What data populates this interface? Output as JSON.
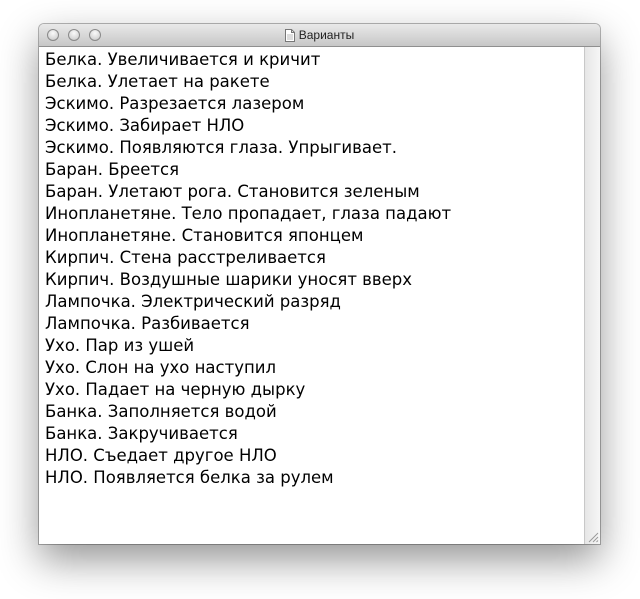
{
  "window": {
    "title": "Варианты",
    "title_icon": "document-icon"
  },
  "document": {
    "lines": [
      "Белка. Увеличивается и кричит",
      "Белка. Улетает на ракете",
      "Эскимо. Разрезается лазером",
      "Эскимо. Забирает НЛО",
      "Эскимо. Появляются глаза. Упрыгивает.",
      "Баран. Бреется",
      "Баран. Улетают рога. Становится зеленым",
      "Инопланетяне. Тело пропадает, глаза падают",
      "Инопланетяне. Становится японцем",
      "Кирпич. Стена расстреливается",
      "Кирпич. Воздушные шарики уносят вверх",
      "Лампочка. Электрический разряд",
      "Лампочка. Разбивается",
      "Ухо. Пар из ушей",
      "Ухо. Слон на ухо наступил",
      "Ухо. Падает на черную дырку",
      "Банка. Заполняется водой",
      "Банка. Закручивается",
      "НЛО. Съедает другое НЛО",
      "НЛО. Появляется белка за рулем"
    ]
  }
}
